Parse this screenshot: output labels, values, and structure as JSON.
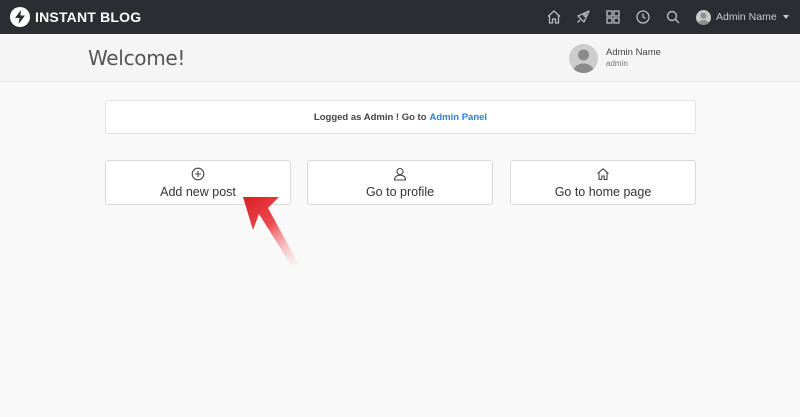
{
  "brand": {
    "name": "INSTANT BLOG",
    "logo_icon": "lightning-bolt-icon"
  },
  "navbar": {
    "icons": [
      "home-icon",
      "rocket-icon",
      "grid-icon",
      "clock-icon",
      "search-icon"
    ],
    "user_name": "Admin Name"
  },
  "header": {
    "welcome": "Welcome!",
    "profile_name": "Admin Name",
    "profile_role": "admin"
  },
  "notice": {
    "text": "Logged as Admin ! Go to",
    "link_label": "Admin Panel"
  },
  "cards": [
    {
      "label": "Add new post",
      "icon": "plus-circle-icon"
    },
    {
      "label": "Go to profile",
      "icon": "user-icon"
    },
    {
      "label": "Go to home page",
      "icon": "home-icon"
    }
  ],
  "colors": {
    "navbar": "#2b2d33",
    "link": "#2f7fd1",
    "pointer_arrow": "#e8262b"
  }
}
